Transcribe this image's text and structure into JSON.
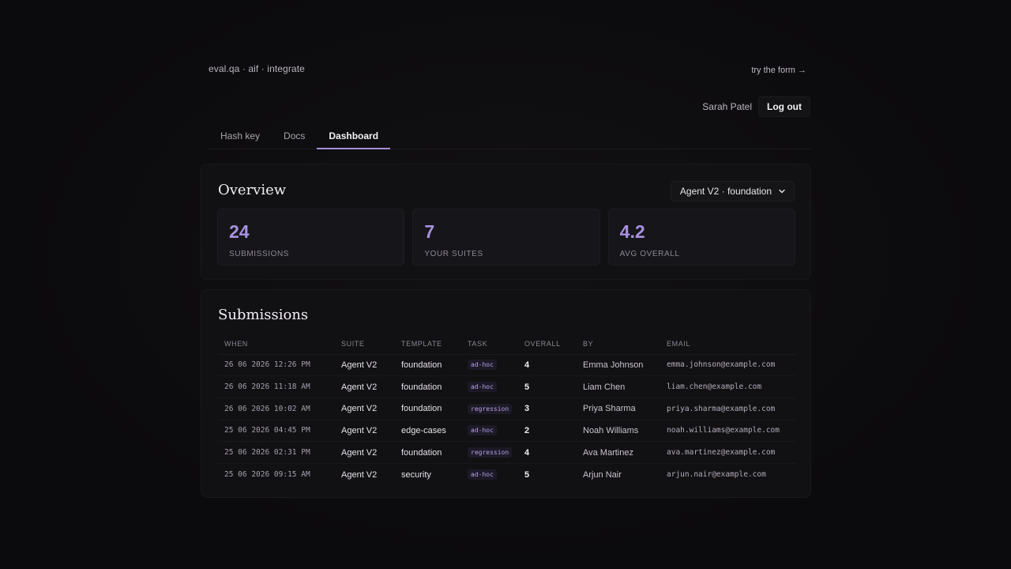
{
  "brand": "eval.qa · aif · integrate",
  "try_form": "try the form →",
  "user": {
    "name": "Sarah Patel",
    "logout_label": "Log out"
  },
  "tabs": [
    {
      "label": "Hash key",
      "active": false
    },
    {
      "label": "Docs",
      "active": false
    },
    {
      "label": "Dashboard",
      "active": true
    }
  ],
  "overview": {
    "title": "Overview",
    "suite_select": {
      "value": "Agent V2 · foundation",
      "icon": "chevron-down-icon"
    },
    "stats": [
      {
        "value": "24",
        "label": "SUBMISSIONS"
      },
      {
        "value": "7",
        "label": "YOUR SUITES"
      },
      {
        "value": "4.2",
        "label": "AVG OVERALL"
      }
    ]
  },
  "submissions": {
    "title": "Submissions",
    "columns": [
      "WHEN",
      "SUITE",
      "TEMPLATE",
      "TASK",
      "OVERALL",
      "BY",
      "EMAIL"
    ],
    "rows": [
      {
        "when": "26 06 2026 12:26 PM",
        "suite": "Agent V2",
        "template": "foundation",
        "task": "ad-hoc",
        "overall": "4",
        "by": "Emma Johnson",
        "email": "emma.johnson@example.com"
      },
      {
        "when": "26 06 2026 11:18 AM",
        "suite": "Agent V2",
        "template": "foundation",
        "task": "ad-hoc",
        "overall": "5",
        "by": "Liam Chen",
        "email": "liam.chen@example.com"
      },
      {
        "when": "26 06 2026 10:02 AM",
        "suite": "Agent V2",
        "template": "foundation",
        "task": "regression",
        "overall": "3",
        "by": "Priya Sharma",
        "email": "priya.sharma@example.com"
      },
      {
        "when": "25 06 2026 04:45 PM",
        "suite": "Agent V2",
        "template": "edge-cases",
        "task": "ad-hoc",
        "overall": "2",
        "by": "Noah Williams",
        "email": "noah.williams@example.com"
      },
      {
        "when": "25 06 2026 02:31 PM",
        "suite": "Agent V2",
        "template": "foundation",
        "task": "regression",
        "overall": "4",
        "by": "Ava Martinez",
        "email": "ava.martinez@example.com"
      },
      {
        "when": "25 06 2026 09:15 AM",
        "suite": "Agent V2",
        "template": "security",
        "task": "ad-hoc",
        "overall": "5",
        "by": "Arjun Nair",
        "email": "arjun.nair@example.com"
      }
    ]
  },
  "colors": {
    "accent": "#a791e0",
    "background": "#0b0a0c",
    "card": "#111013"
  }
}
